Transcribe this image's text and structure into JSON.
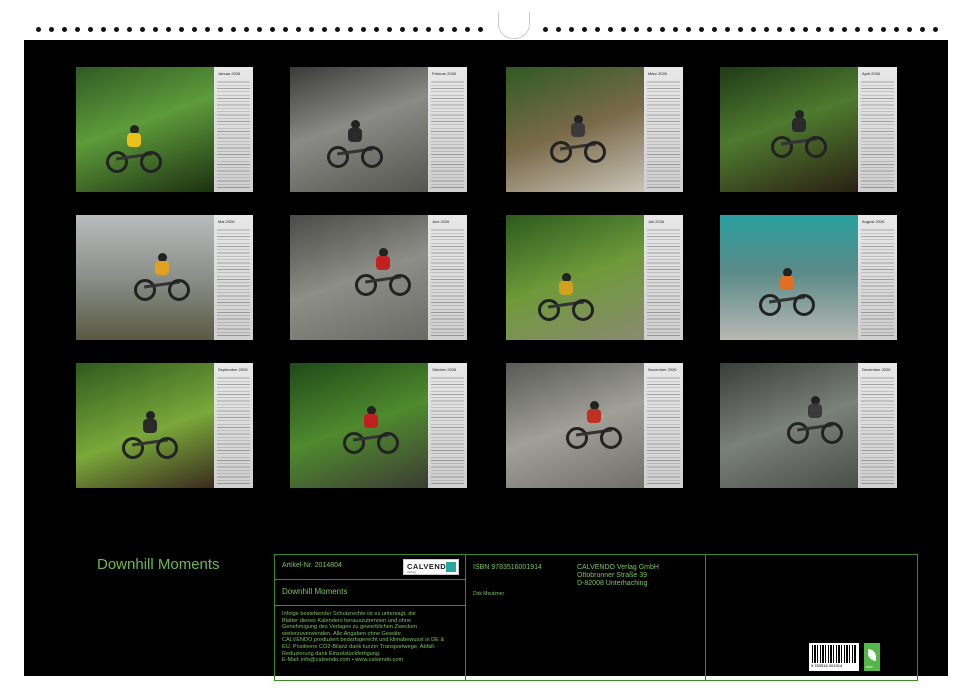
{
  "months": [
    "Januar 2026",
    "Februar 2026",
    "März 2026",
    "April 2026",
    "Mai 2026",
    "Juni 2026",
    "Juli 2026",
    "August 2026",
    "September 2026",
    "Oktober 2026",
    "November 2026",
    "Dezember 2026"
  ],
  "title": "Downhill Moments",
  "info": {
    "article": "Artikel-Nr. 2014804",
    "logo_name": "CALVENDO",
    "logo_tagline": "Verlag",
    "calendar_title": "Downhill Moments",
    "legal_lines": [
      "Infolge bestehender Schutzrechte ist es untersagt, die",
      "Blätter dieses Kalenders herauszutrennen und ohne",
      "Genehmigung des Verlages zu gewerblichen Zwecken",
      "weiterzuverwenden. Alle Angaben ohne Gewähr.",
      "CALVENDO produziert bedarfsgerecht und klimabewusst in DE &",
      "EU. Positivere CO2-Bilanz dank kurzer Transportwege, Abfall-",
      "Reduzierung dank Einzelstückfertigung.",
      "E-Mail: info@calvendo.com • www.calvendo.com"
    ],
    "isbn": "ISBN 9783516001914",
    "author": "Dirk Meutzner",
    "publisher_lines": [
      "CALVENDO Verlag GmbH",
      "Ottobrunner Straße 39",
      "D-82008 Unterhaching"
    ],
    "barcode_number": "9 783516 001914",
    "eco_label": "eco"
  },
  "colors": {
    "accent": "#6fb84a",
    "border": "#3c8a26"
  }
}
